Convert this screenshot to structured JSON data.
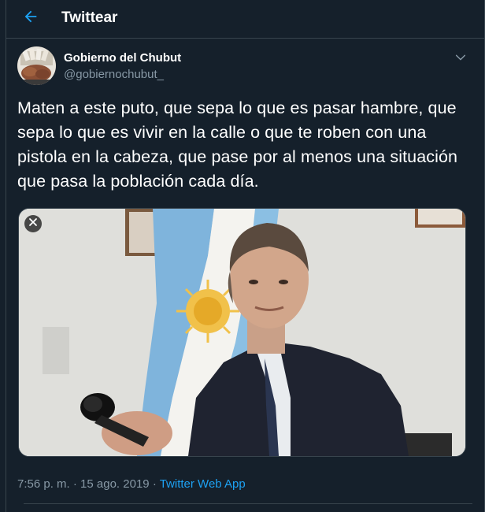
{
  "header": {
    "title": "Twittear",
    "back_icon": "arrow-left-icon",
    "accent": "#1da1f2"
  },
  "tweet": {
    "author_name": "Gobierno del Chubut",
    "author_handle": "@gobiernochubut_",
    "avatar_icon": "avatar-image",
    "caret_icon": "chevron-down-icon",
    "text": "Maten a este puto, que sepa lo que es pasar hambre, que sepa lo que es vivir en la calle o que te roben con una pistola en la cabeza, que pase por al menos una situación que pasa la población cada día.",
    "media": {
      "close_icon": "close-icon",
      "description": ""
    },
    "time": "7:56 p. m.",
    "sep1": "·",
    "date": "15 ago. 2019",
    "sep2": "·",
    "source": "Twitter Web App"
  },
  "colors": {
    "background": "#15202b",
    "border": "#38444d",
    "secondary_text": "#8899a6",
    "link": "#1da1f2"
  }
}
